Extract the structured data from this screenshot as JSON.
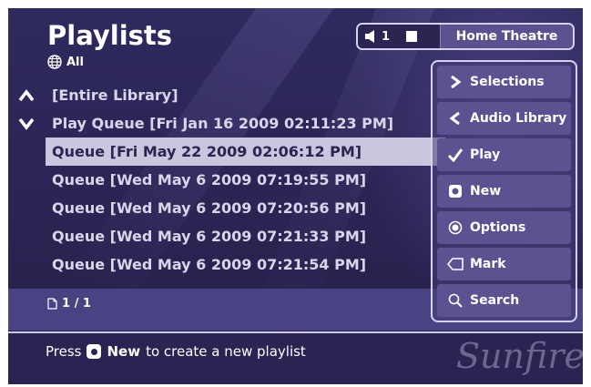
{
  "header": {
    "title": "Playlists",
    "filter_label": "All",
    "zone": {
      "volume_number": "1",
      "zone_name": "Home Theatre"
    }
  },
  "list": {
    "rows": [
      {
        "label": "[Entire Library]"
      },
      {
        "label": "Play Queue [Fri Jan 16 2009 02:11:23 PM]"
      },
      {
        "label": "Queue [Fri May 22 2009 02:06:12 PM]",
        "selected": true
      },
      {
        "label": "Queue [Wed May 6 2009 07:19:55 PM]"
      },
      {
        "label": "Queue [Wed May 6 2009 07:20:56 PM]"
      },
      {
        "label": "Queue [Wed May 6 2009 07:21:33 PM]"
      },
      {
        "label": "Queue [Wed May 6 2009 07:21:54 PM]"
      }
    ],
    "page_info": "1 / 1"
  },
  "menu": {
    "items": [
      {
        "label": "Selections",
        "icon": "chevron-right-icon"
      },
      {
        "label": "Audio Library",
        "icon": "chevron-left-icon"
      },
      {
        "label": "Play",
        "icon": "checkmark-icon"
      },
      {
        "label": "New",
        "icon": "square-button-icon"
      },
      {
        "label": "Options",
        "icon": "radio-circle-icon"
      },
      {
        "label": "Mark",
        "icon": "tag-icon"
      },
      {
        "label": "Search",
        "icon": "search-icon"
      }
    ]
  },
  "footer": {
    "hint_prefix": "Press",
    "hint_button": "New",
    "hint_suffix": "to create a new playlist",
    "logo_text": "Sunfire"
  },
  "colors": {
    "background": "#2b2552",
    "selected_row": "#c9c6dd",
    "menu_item": "#5c5292",
    "page_bar": "#4a4383"
  }
}
